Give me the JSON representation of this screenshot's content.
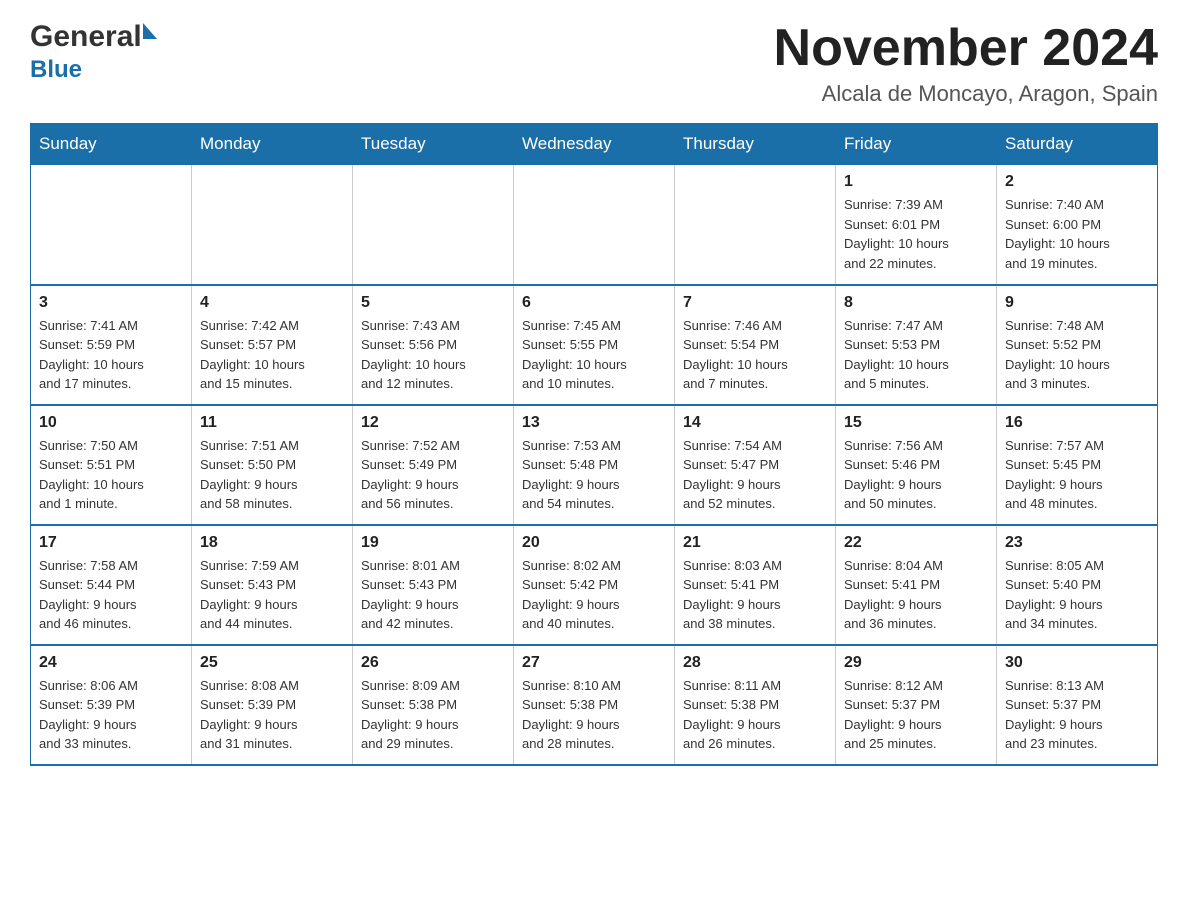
{
  "header": {
    "logo_general": "General",
    "logo_blue": "Blue",
    "month_title": "November 2024",
    "location": "Alcala de Moncayo, Aragon, Spain"
  },
  "weekdays": [
    "Sunday",
    "Monday",
    "Tuesday",
    "Wednesday",
    "Thursday",
    "Friday",
    "Saturday"
  ],
  "weeks": [
    [
      {
        "day": "",
        "info": ""
      },
      {
        "day": "",
        "info": ""
      },
      {
        "day": "",
        "info": ""
      },
      {
        "day": "",
        "info": ""
      },
      {
        "day": "",
        "info": ""
      },
      {
        "day": "1",
        "info": "Sunrise: 7:39 AM\nSunset: 6:01 PM\nDaylight: 10 hours\nand 22 minutes."
      },
      {
        "day": "2",
        "info": "Sunrise: 7:40 AM\nSunset: 6:00 PM\nDaylight: 10 hours\nand 19 minutes."
      }
    ],
    [
      {
        "day": "3",
        "info": "Sunrise: 7:41 AM\nSunset: 5:59 PM\nDaylight: 10 hours\nand 17 minutes."
      },
      {
        "day": "4",
        "info": "Sunrise: 7:42 AM\nSunset: 5:57 PM\nDaylight: 10 hours\nand 15 minutes."
      },
      {
        "day": "5",
        "info": "Sunrise: 7:43 AM\nSunset: 5:56 PM\nDaylight: 10 hours\nand 12 minutes."
      },
      {
        "day": "6",
        "info": "Sunrise: 7:45 AM\nSunset: 5:55 PM\nDaylight: 10 hours\nand 10 minutes."
      },
      {
        "day": "7",
        "info": "Sunrise: 7:46 AM\nSunset: 5:54 PM\nDaylight: 10 hours\nand 7 minutes."
      },
      {
        "day": "8",
        "info": "Sunrise: 7:47 AM\nSunset: 5:53 PM\nDaylight: 10 hours\nand 5 minutes."
      },
      {
        "day": "9",
        "info": "Sunrise: 7:48 AM\nSunset: 5:52 PM\nDaylight: 10 hours\nand 3 minutes."
      }
    ],
    [
      {
        "day": "10",
        "info": "Sunrise: 7:50 AM\nSunset: 5:51 PM\nDaylight: 10 hours\nand 1 minute."
      },
      {
        "day": "11",
        "info": "Sunrise: 7:51 AM\nSunset: 5:50 PM\nDaylight: 9 hours\nand 58 minutes."
      },
      {
        "day": "12",
        "info": "Sunrise: 7:52 AM\nSunset: 5:49 PM\nDaylight: 9 hours\nand 56 minutes."
      },
      {
        "day": "13",
        "info": "Sunrise: 7:53 AM\nSunset: 5:48 PM\nDaylight: 9 hours\nand 54 minutes."
      },
      {
        "day": "14",
        "info": "Sunrise: 7:54 AM\nSunset: 5:47 PM\nDaylight: 9 hours\nand 52 minutes."
      },
      {
        "day": "15",
        "info": "Sunrise: 7:56 AM\nSunset: 5:46 PM\nDaylight: 9 hours\nand 50 minutes."
      },
      {
        "day": "16",
        "info": "Sunrise: 7:57 AM\nSunset: 5:45 PM\nDaylight: 9 hours\nand 48 minutes."
      }
    ],
    [
      {
        "day": "17",
        "info": "Sunrise: 7:58 AM\nSunset: 5:44 PM\nDaylight: 9 hours\nand 46 minutes."
      },
      {
        "day": "18",
        "info": "Sunrise: 7:59 AM\nSunset: 5:43 PM\nDaylight: 9 hours\nand 44 minutes."
      },
      {
        "day": "19",
        "info": "Sunrise: 8:01 AM\nSunset: 5:43 PM\nDaylight: 9 hours\nand 42 minutes."
      },
      {
        "day": "20",
        "info": "Sunrise: 8:02 AM\nSunset: 5:42 PM\nDaylight: 9 hours\nand 40 minutes."
      },
      {
        "day": "21",
        "info": "Sunrise: 8:03 AM\nSunset: 5:41 PM\nDaylight: 9 hours\nand 38 minutes."
      },
      {
        "day": "22",
        "info": "Sunrise: 8:04 AM\nSunset: 5:41 PM\nDaylight: 9 hours\nand 36 minutes."
      },
      {
        "day": "23",
        "info": "Sunrise: 8:05 AM\nSunset: 5:40 PM\nDaylight: 9 hours\nand 34 minutes."
      }
    ],
    [
      {
        "day": "24",
        "info": "Sunrise: 8:06 AM\nSunset: 5:39 PM\nDaylight: 9 hours\nand 33 minutes."
      },
      {
        "day": "25",
        "info": "Sunrise: 8:08 AM\nSunset: 5:39 PM\nDaylight: 9 hours\nand 31 minutes."
      },
      {
        "day": "26",
        "info": "Sunrise: 8:09 AM\nSunset: 5:38 PM\nDaylight: 9 hours\nand 29 minutes."
      },
      {
        "day": "27",
        "info": "Sunrise: 8:10 AM\nSunset: 5:38 PM\nDaylight: 9 hours\nand 28 minutes."
      },
      {
        "day": "28",
        "info": "Sunrise: 8:11 AM\nSunset: 5:38 PM\nDaylight: 9 hours\nand 26 minutes."
      },
      {
        "day": "29",
        "info": "Sunrise: 8:12 AM\nSunset: 5:37 PM\nDaylight: 9 hours\nand 25 minutes."
      },
      {
        "day": "30",
        "info": "Sunrise: 8:13 AM\nSunset: 5:37 PM\nDaylight: 9 hours\nand 23 minutes."
      }
    ]
  ]
}
